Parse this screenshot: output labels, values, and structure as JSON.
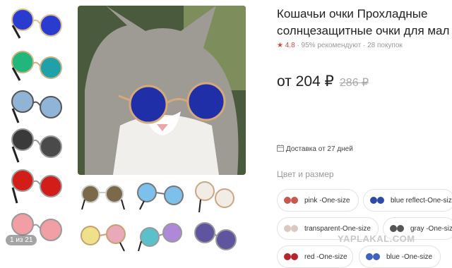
{
  "product": {
    "title_line1": "Кошачьи очки Прохладные",
    "title_line2": "солнцезащитные очки для мал",
    "rating": "★ 4.8",
    "recommend": "95% рекомендуют",
    "purchases": "28 покупок",
    "price": "от 204 ₽",
    "old_price": "286 ₽",
    "delivery": "Доставка от 27 дней",
    "variants_title": "Цвет и размер"
  },
  "gallery": {
    "counter": "1 из 21"
  },
  "variants": [
    {
      "label": "pink -One-size",
      "color": "#c9584c"
    },
    {
      "label": "blue reflect-One-size",
      "color": "#2d4aa7"
    },
    {
      "label": "transparent-One-size",
      "color": "#d9c9c0"
    },
    {
      "label": "gray -One-size",
      "color": "#555555"
    },
    {
      "label": "red -One-size",
      "color": "#b5262a"
    },
    {
      "label": "blue -One-size",
      "color": "#3c63c0"
    }
  ],
  "watermark": "YAPLAKAL.COM",
  "colors": {
    "rating_red": "#d8433b",
    "thumb_colors": [
      "#2a3bd0",
      "#20b87a",
      "#8fb4d8",
      "#3a3a3a",
      "#d21d18",
      "#f19ea5"
    ],
    "bottom_colors": [
      "#7a6a4a",
      "#7ec0ec",
      "#f1ece6",
      "#e9a9b9",
      "#5ac0c9",
      "#5f559e"
    ]
  }
}
